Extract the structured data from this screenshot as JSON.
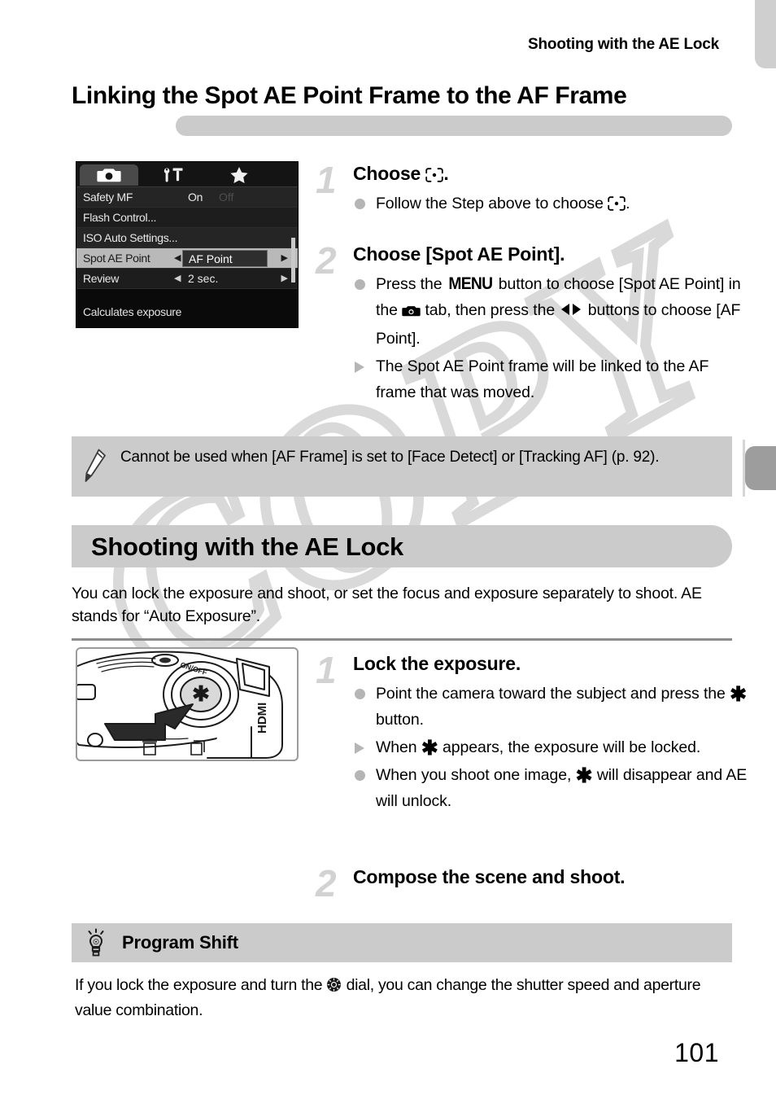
{
  "page": {
    "running_head": "Shooting with the AE Lock",
    "page_number": "101",
    "watermark": "COPY"
  },
  "section": {
    "title": "Linking the Spot AE Point Frame to the AF Frame"
  },
  "lcd_menu": {
    "tabs": [
      {
        "name": "camera-tab",
        "icon": "camera-icon",
        "active": true
      },
      {
        "name": "tools-tab",
        "icon": "wrench-hammer-icon",
        "active": false
      },
      {
        "name": "favorites-tab",
        "icon": "star-icon",
        "active": false
      }
    ],
    "rows": [
      {
        "label": "Safety MF",
        "value": "On",
        "value_dim": "Off",
        "selected": false,
        "arrows": false
      },
      {
        "label": "Flash Control...",
        "value": "",
        "selected": false,
        "arrows": false
      },
      {
        "label": "ISO Auto Settings...",
        "value": "",
        "selected": false,
        "arrows": false
      },
      {
        "label": "Spot AE Point",
        "value": "AF Point",
        "selected": true,
        "arrows": true
      },
      {
        "label": "Review",
        "value": "2 sec.",
        "selected": false,
        "arrows": true
      }
    ],
    "hint": "Calculates exposure",
    "arrow_left": "◀",
    "arrow_right": "▶"
  },
  "steps_top": [
    {
      "number": "1",
      "head_prefix": "Choose ",
      "head_icon": "spot-ae-point-icon",
      "head_suffix": ".",
      "bullets": [
        {
          "mark": "dot",
          "parts": [
            {
              "t": "text",
              "v": "Follow the Step above to choose "
            },
            {
              "t": "icon",
              "v": "spot-ae-point-icon"
            },
            {
              "t": "text",
              "v": "."
            }
          ]
        }
      ]
    },
    {
      "number": "2",
      "head_prefix": "Choose [Spot AE Point].",
      "head_icon": "",
      "head_suffix": "",
      "bullets": [
        {
          "mark": "dot",
          "parts": [
            {
              "t": "text",
              "v": "Press the "
            },
            {
              "t": "icon",
              "v": "menu-icon"
            },
            {
              "t": "text",
              "v": " button to choose [Spot AE Point] in the "
            },
            {
              "t": "icon",
              "v": "camera-icon"
            },
            {
              "t": "text",
              "v": " tab, then press the "
            },
            {
              "t": "icon",
              "v": "left-right-arrows-icon"
            },
            {
              "t": "text",
              "v": " buttons to choose [AF Point]."
            }
          ]
        },
        {
          "mark": "triangle",
          "parts": [
            {
              "t": "text",
              "v": "The Spot AE Point frame will be linked to the AF frame that was moved."
            }
          ]
        }
      ]
    }
  ],
  "note": {
    "icon": "pencil-icon",
    "text": "Cannot be used when [AF Frame] is set to [Face Detect] or [Tracking AF] (p. 92)."
  },
  "ae_section": {
    "header": "Shooting with the AE Lock",
    "intro": "You can lock the exposure and shoot, or set the focus and exposure separately to shoot. AE stands for “Auto Exposure”.",
    "illustration": "camera-ae-lock-button-illustration"
  },
  "steps_bottom": [
    {
      "number": "1",
      "head_prefix": "Lock the exposure.",
      "bullets": [
        {
          "mark": "dot",
          "parts": [
            {
              "t": "text",
              "v": "Point the camera toward the subject and press the "
            },
            {
              "t": "icon",
              "v": "ae-lock-star-icon"
            },
            {
              "t": "text",
              "v": " button."
            }
          ]
        },
        {
          "mark": "triangle",
          "parts": [
            {
              "t": "text",
              "v": "When "
            },
            {
              "t": "icon",
              "v": "ae-lock-star-icon"
            },
            {
              "t": "text",
              "v": " appears, the exposure will be locked."
            }
          ]
        },
        {
          "mark": "dot",
          "parts": [
            {
              "t": "text",
              "v": "When you shoot one image, "
            },
            {
              "t": "icon",
              "v": "ae-lock-star-icon"
            },
            {
              "t": "text",
              "v": " will disappear and AE will unlock."
            }
          ]
        }
      ]
    },
    {
      "number": "2",
      "head_prefix": "Compose the scene and shoot.",
      "bullets": []
    }
  ],
  "tip": {
    "icon": "lightbulb-icon",
    "title": "Program Shift",
    "text_parts": [
      {
        "t": "text",
        "v": "If you lock the exposure and turn the "
      },
      {
        "t": "icon",
        "v": "control-dial-icon"
      },
      {
        "t": "text",
        "v": " dial, you can change the shutter speed and aperture value combination."
      }
    ]
  },
  "colors": {
    "grey_box": "#cbcbcb",
    "tab_active": "#9d9d9d",
    "tab_top": "#cfcfcf",
    "step_number": "#d2d2d2",
    "bullet_mark": "#b5b5b5",
    "divider": "#8c8c8c",
    "watermark": "#d9d9d9"
  }
}
